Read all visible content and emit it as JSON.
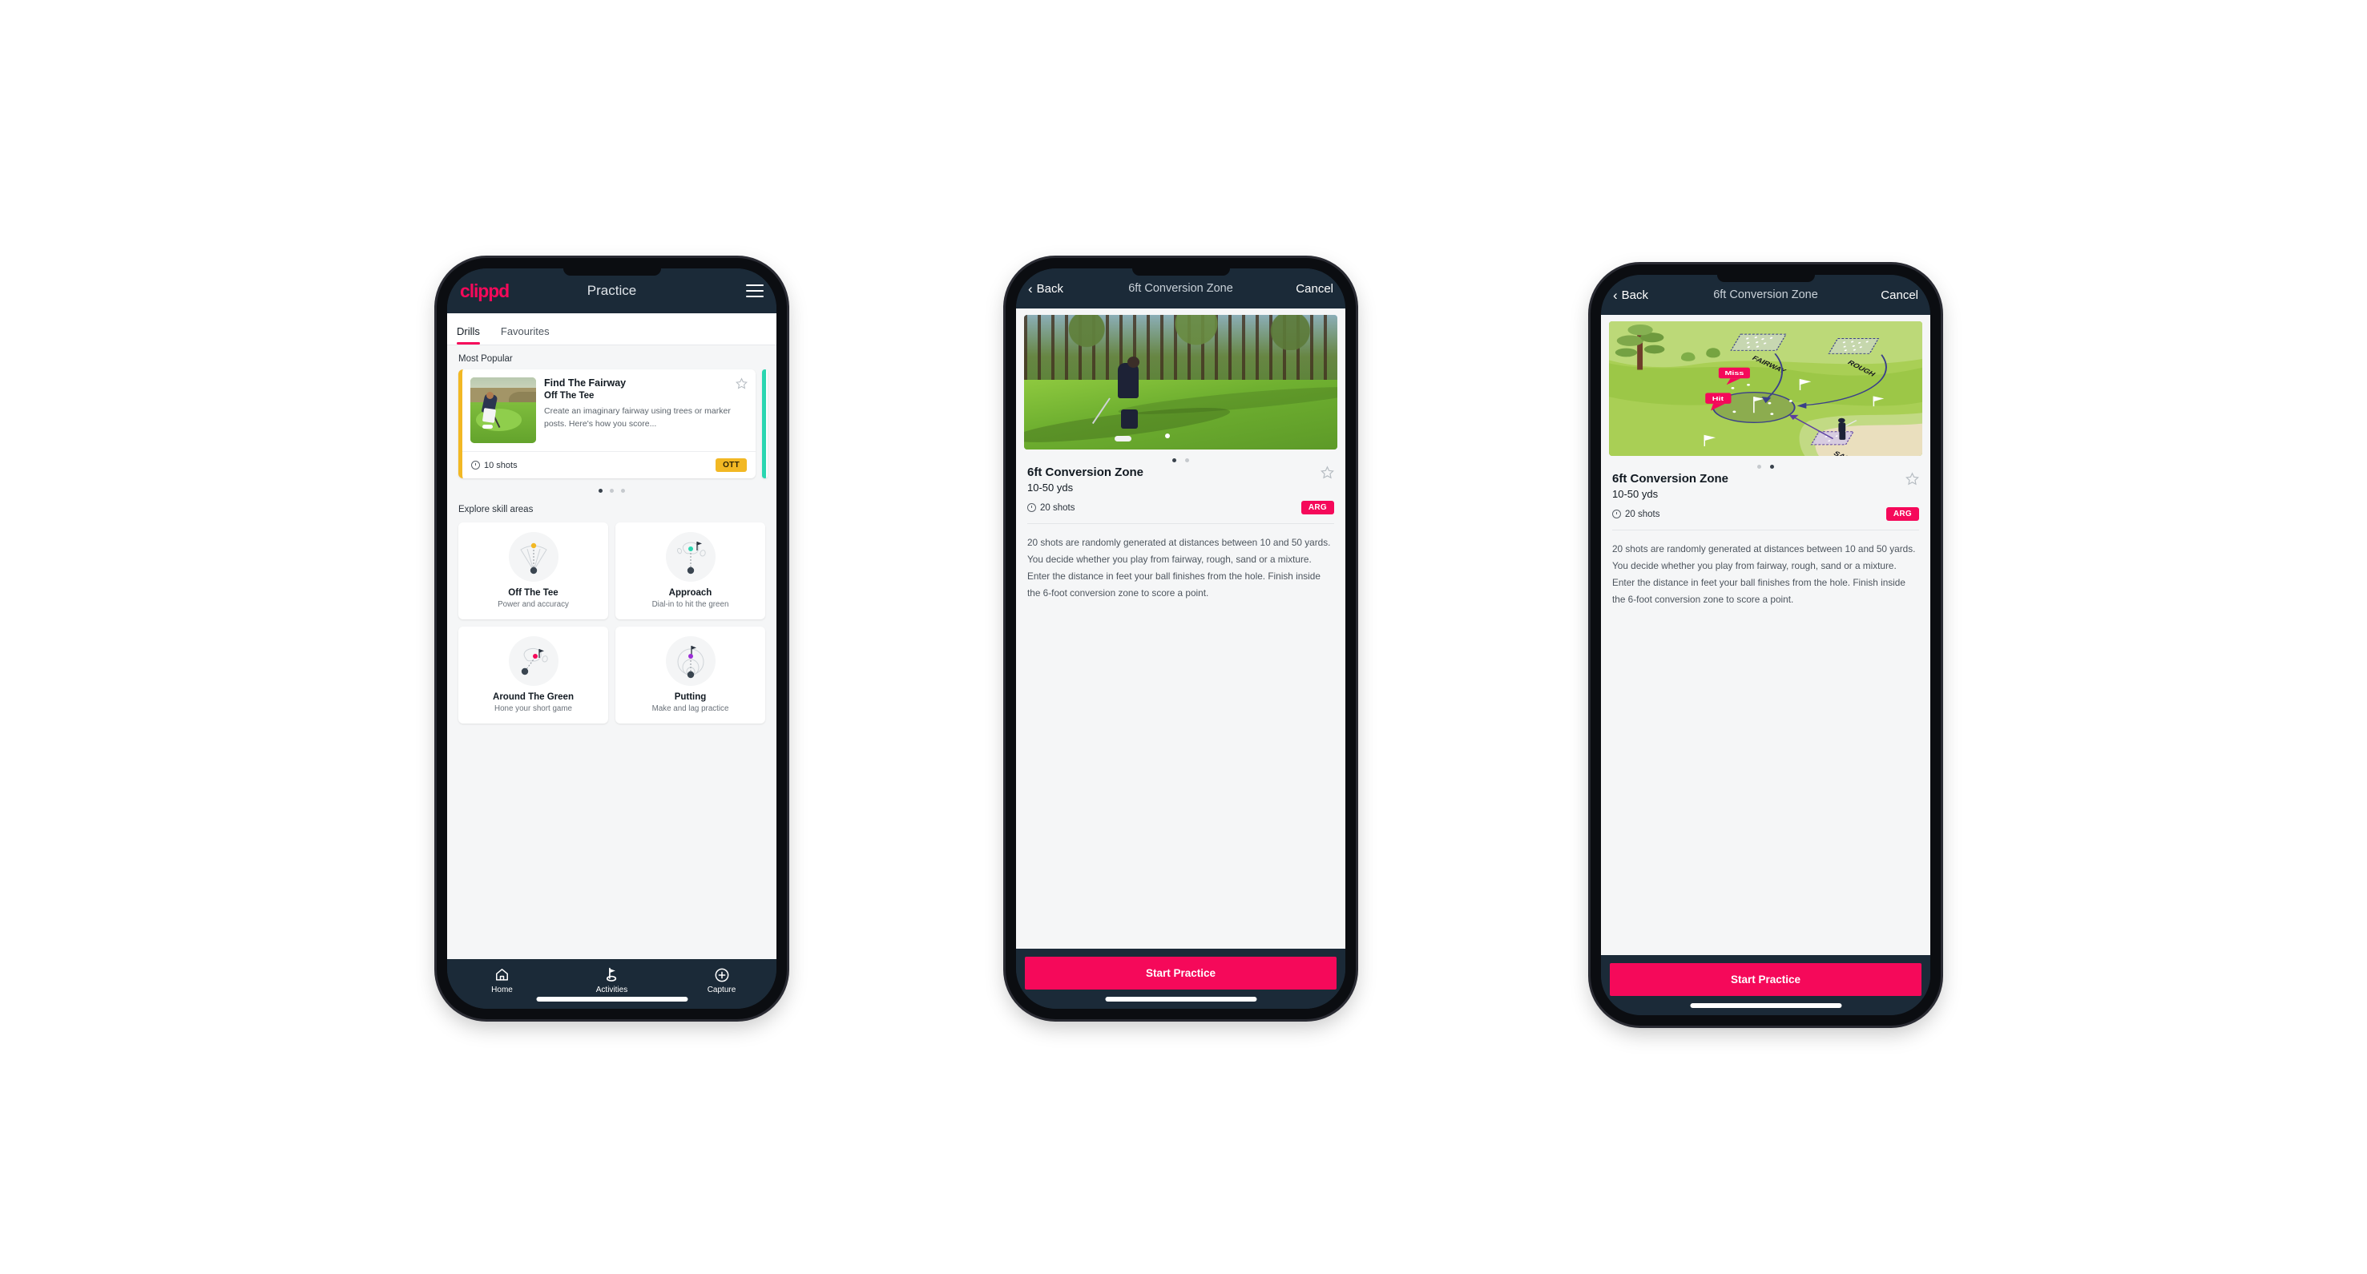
{
  "app": {
    "brand": "clippd",
    "accent_pink": "#f5095a",
    "header_navy": "#1b2a38",
    "tag_yellow": "#f2b824",
    "teal": "#2ad6b0"
  },
  "phone1": {
    "header": {
      "brand": "clippd",
      "title": "Practice",
      "menu_icon": "hamburger-icon"
    },
    "tabs": [
      {
        "label": "Drills",
        "active": true
      },
      {
        "label": "Favourites",
        "active": false
      }
    ],
    "most_popular": {
      "section_label": "Most Popular",
      "card": {
        "title": "Find The Fairway",
        "subtitle": "Off The Tee",
        "description": "Create an imaginary fairway using trees or marker posts. Here's how you score...",
        "shots": "10 shots",
        "tag": "OTT",
        "tag_color": "#f2b824",
        "accent_bar": "#f2b824",
        "favourite_icon": "star-outline-icon"
      },
      "carousel_dots": {
        "count": 3,
        "active_index": 0
      }
    },
    "skill_areas": {
      "section_label": "Explore skill areas",
      "items": [
        {
          "name": "Off The Tee",
          "desc": "Power and accuracy",
          "icon": "tee-fan-icon",
          "dot_color": "#f2b824"
        },
        {
          "name": "Approach",
          "desc": "Dial-in to hit the green",
          "icon": "approach-green-icon",
          "dot_color": "#2ad6b0"
        },
        {
          "name": "Around The Green",
          "desc": "Hone your short game",
          "icon": "chip-green-icon",
          "dot_color": "#f5095a"
        },
        {
          "name": "Putting",
          "desc": "Make and lag practice",
          "icon": "putting-rings-icon",
          "dot_color": "#9b2ed6"
        }
      ]
    },
    "bottom_nav": [
      {
        "label": "Home",
        "icon": "home-icon",
        "active": false
      },
      {
        "label": "Activities",
        "icon": "golf-flag-icon",
        "active": true
      },
      {
        "label": "Capture",
        "icon": "plus-circle-icon",
        "active": false
      }
    ]
  },
  "phone2": {
    "nav": {
      "back": "Back",
      "title": "6ft Conversion Zone",
      "cancel": "Cancel",
      "back_icon": "chevron-left-icon"
    },
    "media": {
      "kind": "photo",
      "alt": "golfer-chipping-photo"
    },
    "carousel_dots": {
      "count": 2,
      "active_index": 0
    },
    "detail": {
      "title": "6ft Conversion Zone",
      "distance": "10-50 yds",
      "shots": "20 shots",
      "tag": "ARG",
      "tag_color": "#f5095a",
      "favourite_icon": "star-outline-icon",
      "description": "20 shots are randomly generated at distances between 10 and 50 yards. You decide whether you play from fairway, rough, sand or a mixture. Enter the distance in feet your ball finishes from the hole. Finish inside the 6-foot conversion zone to score a point."
    },
    "cta": "Start Practice"
  },
  "phone3": {
    "nav": {
      "back": "Back",
      "title": "6ft Conversion Zone",
      "cancel": "Cancel",
      "back_icon": "chevron-left-icon"
    },
    "media": {
      "kind": "illustration",
      "alt": "golf-hole-diagram",
      "labels": {
        "fairway": "FAIRWAY",
        "rough": "ROUGH",
        "sand": "SAND",
        "miss": "Miss",
        "hit": "Hit"
      }
    },
    "carousel_dots": {
      "count": 2,
      "active_index": 1
    },
    "detail": {
      "title": "6ft Conversion Zone",
      "distance": "10-50 yds",
      "shots": "20 shots",
      "tag": "ARG",
      "tag_color": "#f5095a",
      "favourite_icon": "star-outline-icon",
      "description": "20 shots are randomly generated at distances between 10 and 50 yards. You decide whether you play from fairway, rough, sand or a mixture. Enter the distance in feet your ball finishes from the hole. Finish inside the 6-foot conversion zone to score a point."
    },
    "cta": "Start Practice"
  }
}
